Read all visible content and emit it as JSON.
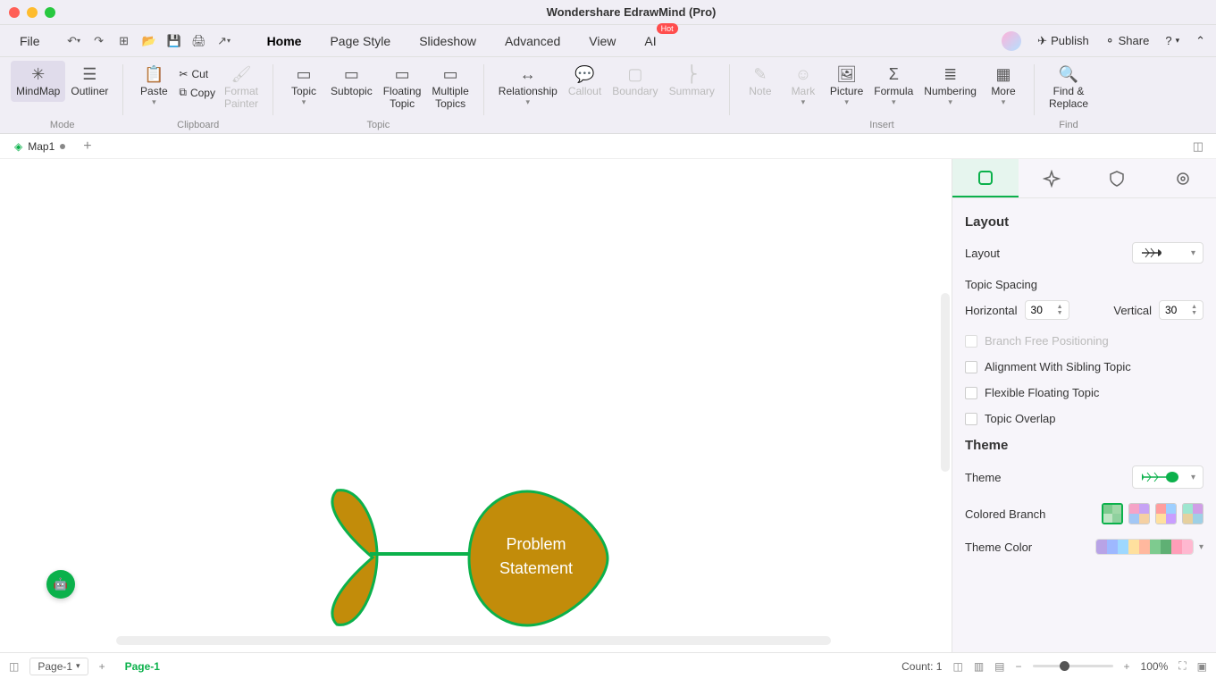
{
  "app": {
    "title": "Wondershare EdrawMind (Pro)"
  },
  "menu": {
    "file": "File",
    "tabs": [
      "Home",
      "Page Style",
      "Slideshow",
      "Advanced",
      "View",
      "AI"
    ],
    "active": "Home",
    "hot": "Hot",
    "publish": "Publish",
    "share": "Share"
  },
  "ribbon": {
    "mode": {
      "label": "Mode",
      "mindmap": "MindMap",
      "outliner": "Outliner"
    },
    "clipboard": {
      "label": "Clipboard",
      "paste": "Paste",
      "cut": "Cut",
      "copy": "Copy",
      "format_painter": "Format\nPainter"
    },
    "topicgrp": {
      "label": "Topic",
      "topic": "Topic",
      "subtopic": "Subtopic",
      "floating": "Floating\nTopic",
      "multiple": "Multiple\nTopics"
    },
    "relationship": "Relationship",
    "callout": "Callout",
    "boundary": "Boundary",
    "summary": "Summary",
    "insert": {
      "label": "Insert",
      "note": "Note",
      "mark": "Mark",
      "picture": "Picture",
      "formula": "Formula",
      "numbering": "Numbering",
      "more": "More"
    },
    "find": {
      "label": "Find",
      "find_replace": "Find &\nReplace"
    }
  },
  "tabs": {
    "doc": "Map1"
  },
  "canvas": {
    "central_text": "Problem\nStatement"
  },
  "side": {
    "layout_title": "Layout",
    "layout_label": "Layout",
    "topic_spacing": "Topic Spacing",
    "horizontal": "Horizontal",
    "hval": "30",
    "vertical": "Vertical",
    "vval": "30",
    "branch_free": "Branch Free Positioning",
    "align_sibling": "Alignment With Sibling Topic",
    "flex_float": "Flexible Floating Topic",
    "overlap": "Topic Overlap",
    "theme_title": "Theme",
    "theme_label": "Theme",
    "colored_branch": "Colored Branch",
    "theme_color": "Theme Color"
  },
  "status": {
    "page_dd": "Page-1",
    "page_active": "Page-1",
    "count": "Count: 1",
    "zoom": "100%"
  }
}
